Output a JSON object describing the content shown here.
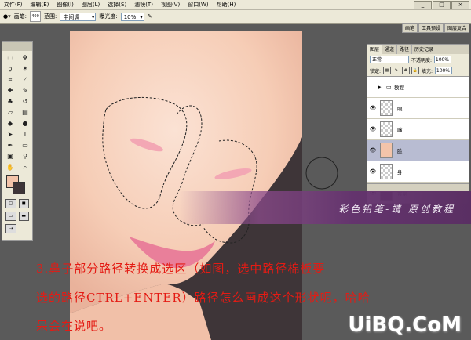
{
  "menu": [
    "文件(F)",
    "编辑(E)",
    "图像(I)",
    "图层(L)",
    "选择(S)",
    "滤镜(T)",
    "视图(V)",
    "窗口(W)",
    "帮助(H)"
  ],
  "options": {
    "brush_label": "画笔:",
    "brush_size": "400",
    "range_label": "范围:",
    "range_value": "中间调",
    "exposure_label": "曝光度:",
    "exposure_value": "10%"
  },
  "dock_tabs": [
    "画笔",
    "工具预设",
    "图层复合"
  ],
  "layers_panel": {
    "tabs": [
      "图层",
      "通道",
      "路径",
      "历史记录"
    ],
    "blend_mode": "正常",
    "opacity_label": "不透明度:",
    "opacity_value": "100%",
    "lock_label": "锁定:",
    "fill_label": "填充:",
    "fill_value": "100%",
    "layers": [
      {
        "name": "教程",
        "type": "folder",
        "visible": false
      },
      {
        "name": "眼",
        "type": "layer",
        "visible": true
      },
      {
        "name": "嘴",
        "type": "layer",
        "visible": true
      },
      {
        "name": "脸",
        "type": "layer",
        "visible": true,
        "selected": true
      },
      {
        "name": "身",
        "type": "layer",
        "visible": true
      },
      {
        "name": "背景",
        "type": "background",
        "visible": true,
        "locked": true
      }
    ]
  },
  "banner_text": "彩色铅笔-靖 原创教程",
  "caption_lines": [
    "3.鼻子部分路径转换成选区（如图，选中路径棉板要",
    "选的路径CTRL+ENTER）路径怎么画成这个形状呢，哈哈",
    "呆会在说吧。"
  ],
  "watermark": "UiBQ.CoM",
  "colors": {
    "foreground": "#f3c4aa",
    "background": "#3e3538",
    "caption": "#e41b14",
    "skin": "#f6cdb6",
    "shadow": "#3e3538"
  }
}
